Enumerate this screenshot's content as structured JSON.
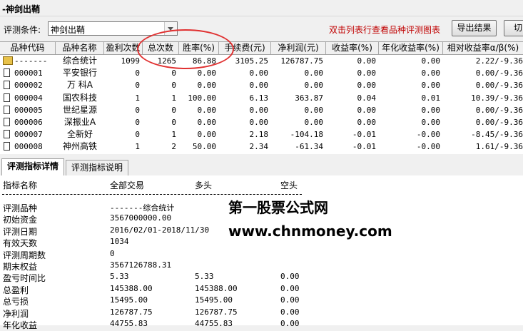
{
  "window": {
    "title": "-神剑出鞘"
  },
  "toolbar": {
    "condition_label": "评测条件:",
    "condition_value": "神剑出鞘",
    "hint": "双击列表行查看品种评测图表",
    "export_label": "导出结果",
    "switch_label": "切"
  },
  "grid": {
    "headers": [
      "品种代码",
      "品种名称",
      "盈利次数",
      "总次数",
      "胜率(%)",
      "手续费(元)",
      "净利润(元)",
      "收益率(%)",
      "年化收益率(%)",
      "相对收益率α/β(%)"
    ],
    "rows": [
      {
        "code": "-------",
        "name": "综合统计",
        "wins": "1099",
        "total": "1265",
        "winrate": "86.88",
        "fee": "3105.25",
        "profit": "126787.75",
        "ret": "0.00",
        "annual": "0.00",
        "rel": "2.22/-9.36"
      },
      {
        "code": "000001",
        "name": "平安银行",
        "wins": "0",
        "total": "0",
        "winrate": "0.00",
        "fee": "0.00",
        "profit": "0.00",
        "ret": "0.00",
        "annual": "0.00",
        "rel": "0.00/-9.36"
      },
      {
        "code": "000002",
        "name": "万 科A",
        "wins": "0",
        "total": "0",
        "winrate": "0.00",
        "fee": "0.00",
        "profit": "0.00",
        "ret": "0.00",
        "annual": "0.00",
        "rel": "0.00/-9.36"
      },
      {
        "code": "000004",
        "name": "国农科技",
        "wins": "1",
        "total": "1",
        "winrate": "100.00",
        "fee": "6.13",
        "profit": "363.87",
        "ret": "0.04",
        "annual": "0.01",
        "rel": "10.39/-9.36"
      },
      {
        "code": "000005",
        "name": "世纪星源",
        "wins": "0",
        "total": "0",
        "winrate": "0.00",
        "fee": "0.00",
        "profit": "0.00",
        "ret": "0.00",
        "annual": "0.00",
        "rel": "0.00/-9.36"
      },
      {
        "code": "000006",
        "name": "深振业A",
        "wins": "0",
        "total": "0",
        "winrate": "0.00",
        "fee": "0.00",
        "profit": "0.00",
        "ret": "0.00",
        "annual": "0.00",
        "rel": "0.00/-9.36"
      },
      {
        "code": "000007",
        "name": "全新好",
        "wins": "0",
        "total": "1",
        "winrate": "0.00",
        "fee": "2.18",
        "profit": "-104.18",
        "ret": "-0.01",
        "annual": "-0.00",
        "rel": "-8.45/-9.36"
      },
      {
        "code": "000008",
        "name": "神州高铁",
        "wins": "1",
        "total": "2",
        "winrate": "50.00",
        "fee": "2.34",
        "profit": "-61.34",
        "ret": "-0.01",
        "annual": "-0.00",
        "rel": "1.61/-9.36"
      }
    ]
  },
  "tabs": [
    "评测指标详情",
    "评测指标说明"
  ],
  "detail": {
    "headers": [
      "指标名称",
      "全部交易",
      "多头",
      "空头"
    ],
    "separator": "------------------------------------------------------------------",
    "rows": [
      {
        "label": "评测品种",
        "all": "-------综合统计",
        "long": "",
        "short": ""
      },
      {
        "label": "初始资金",
        "all": "3567000000.00",
        "long": "",
        "short": ""
      },
      {
        "label": "评测日期",
        "all": "2016/02/01-2018/11/30",
        "long": "",
        "short": ""
      },
      {
        "label": "有效天数",
        "all": "1034",
        "long": "",
        "short": ""
      },
      {
        "label": "评测周期数",
        "all": "0",
        "long": "",
        "short": ""
      },
      {
        "label": "期末权益",
        "all": "3567126788.31",
        "long": "",
        "short": ""
      },
      {
        "label": "盈亏时间比",
        "all": "5.33",
        "long": "5.33",
        "short": "0.00"
      },
      {
        "label": "总盈利",
        "all": "145388.00",
        "long": "145388.00",
        "short": "0.00"
      },
      {
        "label": "总亏损",
        "all": "15495.00",
        "long": "15495.00",
        "short": "0.00"
      },
      {
        "label": "净利润",
        "all": "126787.75",
        "long": "126787.75",
        "short": "0.00"
      },
      {
        "label": "年化收益",
        "all": "44755.83",
        "long": "44755.83",
        "short": "0.00"
      }
    ]
  },
  "watermark": {
    "line1": "第一股票公式网",
    "line2": "www.chnmoney.com"
  }
}
